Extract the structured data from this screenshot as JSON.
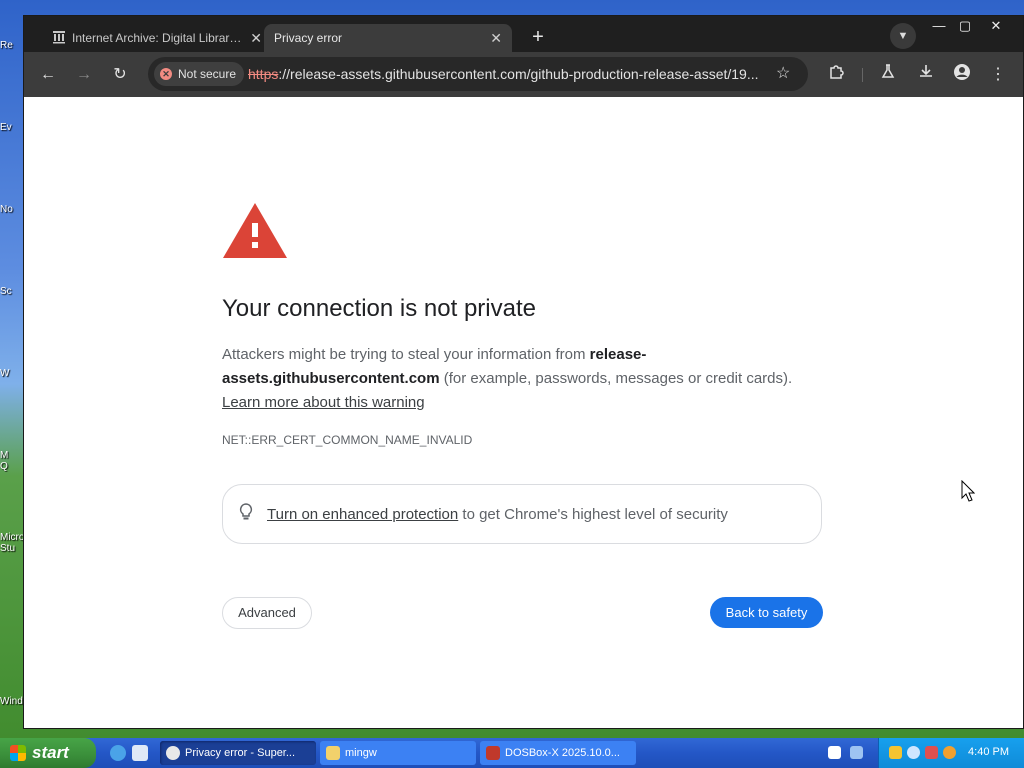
{
  "desktop": {
    "labels": [
      "Re",
      "Ev",
      "No",
      "Sc",
      "W",
      "M\nQ",
      "Micro\nStu",
      "Wind"
    ]
  },
  "tabs": [
    {
      "title": "Internet Archive: Digital Library of",
      "icon": "library-icon"
    },
    {
      "title": "Privacy error",
      "icon": ""
    }
  ],
  "address_bar": {
    "security_chip": "Not secure",
    "scheme": "https",
    "rest": "://release-assets.githubusercontent.com/github-production-release-asset/19..."
  },
  "page": {
    "heading": "Your connection is not private",
    "explain_prefix": "Attackers might be trying to steal your information from ",
    "explain_host": "release-assets.githubusercontent.com",
    "explain_suffix": " (for example, passwords, messages or credit cards).",
    "learn_more": "Learn more about this warning",
    "error_code": "NET::ERR_CERT_COMMON_NAME_INVALID",
    "enhanced_link": "Turn on enhanced protection",
    "enhanced_rest": " to get Chrome's highest level of security",
    "advanced_label": "Advanced",
    "back_label": "Back to safety"
  },
  "taskbar": {
    "start_label": "start",
    "tasks": [
      {
        "label": "Privacy error - Super...",
        "active": true
      },
      {
        "label": "mingw",
        "active": false
      },
      {
        "label": "DOSBox-X 2025.10.0...",
        "active": false
      }
    ],
    "clock": "4:40 PM"
  },
  "colors": {
    "accent": "#1a73e8",
    "warning_red": "#db4437",
    "not_secure_red": "#f28b82"
  }
}
